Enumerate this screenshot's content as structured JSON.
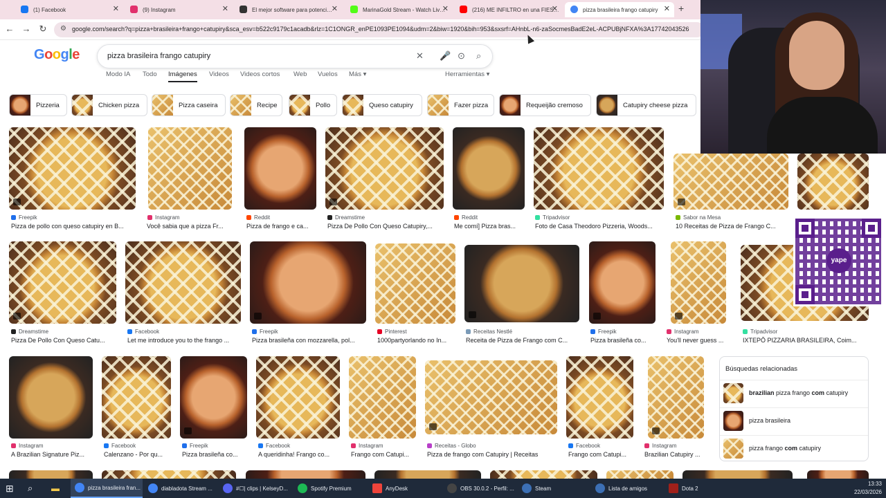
{
  "browser": {
    "tabs": [
      {
        "title": "(1) Facebook",
        "color": "#1877f2"
      },
      {
        "title": "(9) Instagram",
        "color": "#e1306c"
      },
      {
        "title": "El mejor software para potenci…",
        "color": "#333333"
      },
      {
        "title": "MarinaGold Stream - Watch Liv…",
        "color": "#53fc18"
      },
      {
        "title": "(216) ME INFILTRO en una FIES…",
        "color": "#ff0000"
      },
      {
        "title": "pizza brasileira frango catupiry",
        "color": "#4285f4"
      }
    ],
    "url": "google.com/search?q=pizza+brasileira+frango+catupiry&sca_esv=b522c9179c1acadb&rlz=1C1ONGR_enPE1093PE1094&udm=2&biw=1920&bih=953&sxsrf=AHnbL-n6-zaSocmesBadE2eL-ACPUBjNFXA%3A17742043526"
  },
  "search": {
    "logo": [
      "G",
      "o",
      "o",
      "g",
      "l",
      "e"
    ],
    "query": "pizza brasileira frango catupiry",
    "modes": [
      "Modo IA",
      "Todo",
      "Imágenes",
      "Videos",
      "Videos cortos",
      "Web",
      "Vuelos",
      "Más ▾",
      "Herramientas ▾"
    ],
    "active_mode": "Imágenes"
  },
  "chips": [
    "Pizzeria",
    "Chicken pizza",
    "Pizza caseira",
    "Recipe",
    "Pollo",
    "Queso catupiry",
    "Fazer pizza",
    "Requeijão cremoso",
    "Catupiry cheese pizza"
  ],
  "results": [
    {
      "source": "Freepik",
      "caption": "Pizza de pollo con queso catupiry en B...",
      "color": "#1f6feb"
    },
    {
      "source": "Instagram",
      "caption": "Você sabia que a pizza Fr...",
      "color": "#e1306c"
    },
    {
      "source": "Reddit",
      "caption": "Pizza de frango e ca...",
      "color": "#ff4500"
    },
    {
      "source": "Dreamstime",
      "caption": "Pizza De Pollo Con Queso Catupiry,...",
      "color": "#222222"
    },
    {
      "source": "Reddit",
      "caption": "Me comí] Pizza bras...",
      "color": "#ff4500"
    },
    {
      "source": "Tripadvisor",
      "caption": "Foto de Casa Theodoro Pizzeria, Woods...",
      "color": "#34e0a1"
    },
    {
      "source": "Sabor na Mesa",
      "caption": "10 Receitas de Pizza de Frango C...",
      "color": "#7ab800"
    },
    {
      "source": "Dreamstime",
      "caption": "Pizza De Pollo Con Queso Catu...",
      "color": "#222222"
    },
    {
      "source": "Facebook",
      "caption": "Let me introduce you to the frango ...",
      "color": "#1877f2"
    },
    {
      "source": "Freepik",
      "caption": "Pizza brasileña con mozzarella, pol...",
      "color": "#1f6feb"
    },
    {
      "source": "Pinterest",
      "caption": "1000partyorlando no In...",
      "color": "#e60023"
    },
    {
      "source": "Receitas Nestlé",
      "caption": "Receita de Pizza de Frango com C...",
      "color": "#7b9bb8"
    },
    {
      "source": "Freepik",
      "caption": "Pizza brasileña co...",
      "color": "#1f6feb"
    },
    {
      "source": "Instagram",
      "caption": "You'll never guess ...",
      "color": "#e1306c"
    },
    {
      "source": "Tripadvisor",
      "caption": "IXTEPÔ PIZZARIA BRASILEIRA, Coim...",
      "color": "#34e0a1"
    },
    {
      "source": "Instagram",
      "caption": "A Brazilian Signature Piz...",
      "color": "#e1306c"
    },
    {
      "source": "Facebook",
      "caption": "Calenzano - Por qu...",
      "color": "#1877f2"
    },
    {
      "source": "Freepik",
      "caption": "Pizza brasileña co...",
      "color": "#1f6feb"
    },
    {
      "source": "Facebook",
      "caption": "A queridinha! Frango co...",
      "color": "#1877f2"
    },
    {
      "source": "Instagram",
      "caption": "Frango com Catupi...",
      "color": "#e1306c"
    },
    {
      "source": "Receitas - Globo",
      "caption": "Pizza de frango com Catupiry | Receitas",
      "color": "#b83fc9"
    },
    {
      "source": "Facebook",
      "caption": "Frango com Catupi...",
      "color": "#1877f2"
    },
    {
      "source": "Instagram",
      "caption": "Brazilian Catupiry ...",
      "color": "#e1306c"
    }
  ],
  "related": {
    "title": "Búsquedas relacionadas",
    "items": [
      {
        "bold1": "brazilian",
        "normal1": " pizza frango ",
        "bold2": "com",
        "normal2": " catupiry"
      },
      {
        "bold1": "",
        "normal1": "pizza brasileira",
        "bold2": "",
        "normal2": ""
      },
      {
        "bold1": "",
        "normal1": "pizza frango ",
        "bold2": "com",
        "normal2": " catupiry"
      }
    ]
  },
  "overlay": {
    "qr_label": "yape"
  },
  "taskbar": {
    "items": [
      {
        "label": "pizza brasileira fran...",
        "color": "#4285f4"
      },
      {
        "label": "diabladota Stream ...",
        "color": "#4285f4"
      },
      {
        "label": "#☐| clips | KelseyD...",
        "color": "#5865f2"
      },
      {
        "label": "Spotify Premium",
        "color": "#1db954"
      },
      {
        "label": "AnyDesk",
        "color": "#ef443b"
      },
      {
        "label": "OBS 30.0.2 - Perfil: ...",
        "color": "#444444"
      },
      {
        "label": "Steam",
        "color": "#1b2838"
      },
      {
        "label": "Lista de amigos",
        "color": "#1b2838"
      },
      {
        "label": "Dota 2",
        "color": "#a0201a"
      }
    ],
    "time": "13:33",
    "date": "22/03/2026"
  }
}
